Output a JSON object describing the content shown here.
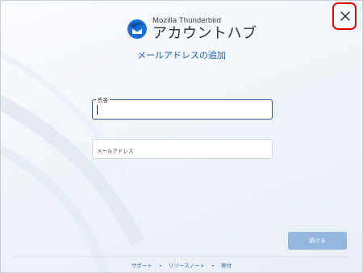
{
  "header": {
    "brand": "Mozilla Thunderbird",
    "hub_title": "アカウントハブ",
    "subtitle": "メールアドレスの追加",
    "close_icon": "close-icon"
  },
  "form": {
    "name_field": {
      "label": "氏名",
      "value": ""
    },
    "email_field": {
      "placeholder": "メールアドレス",
      "value": ""
    }
  },
  "actions": {
    "continue_label": "続ける"
  },
  "footer": {
    "links": [
      "サポート",
      "リリースノート",
      "寄付"
    ],
    "separator": "•"
  },
  "colors": {
    "accent": "#1d64a8",
    "button_disabled": "#93b6df",
    "highlight": "#e00000"
  }
}
